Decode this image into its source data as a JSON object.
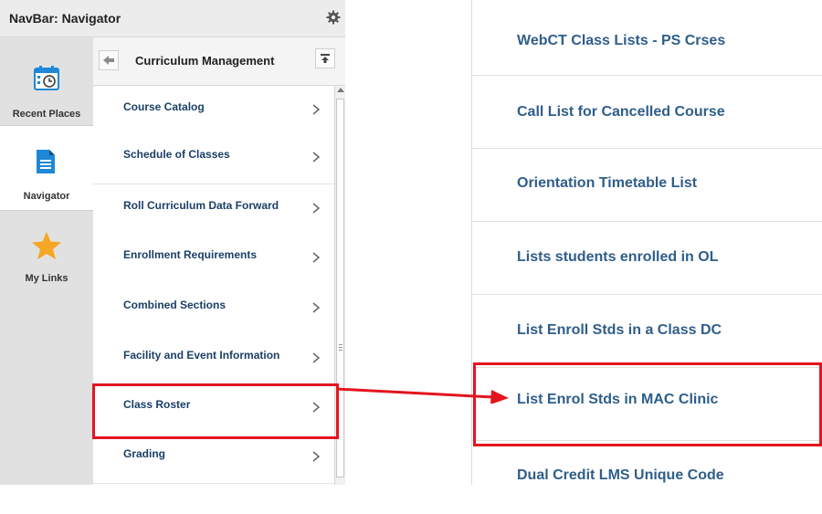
{
  "navbar": {
    "title": "NavBar: Navigator",
    "settings_icon": "gear-icon"
  },
  "rail": {
    "items": [
      {
        "label": "Recent Places",
        "icon": "calendar-clock-icon",
        "active": false
      },
      {
        "label": "Navigator",
        "icon": "document-icon",
        "active": true
      },
      {
        "label": "My Links",
        "icon": "star-icon",
        "active": false
      }
    ]
  },
  "folder": {
    "title": "Curriculum Management",
    "back_icon": "back-arrow-icon",
    "top_icon": "collapse-top-icon"
  },
  "menu": {
    "items": [
      {
        "label": "Course Catalog"
      },
      {
        "label": "Schedule of Classes"
      },
      {
        "label": "Roll Curriculum Data Forward"
      },
      {
        "label": "Enrollment Requirements"
      },
      {
        "label": "Combined Sections"
      },
      {
        "label": "Facility and Event Information"
      },
      {
        "label": "Class Roster"
      },
      {
        "label": "Grading"
      }
    ]
  },
  "reports": {
    "items": [
      {
        "label": "WebCT Class Lists - PS Crses"
      },
      {
        "label": "Call List for Cancelled Course"
      },
      {
        "label": "Orientation Timetable List"
      },
      {
        "label": "Lists students enrolled in OL"
      },
      {
        "label": "List Enroll Stds in a Class DC"
      },
      {
        "label": "List Enrol Stds in MAC Clinic"
      },
      {
        "label": "Dual Credit LMS Unique Code"
      }
    ]
  },
  "colors": {
    "highlight": "#e3151f",
    "link": "#2f5e8a",
    "accent_blue": "#1e88d6",
    "star": "#f5a623"
  }
}
